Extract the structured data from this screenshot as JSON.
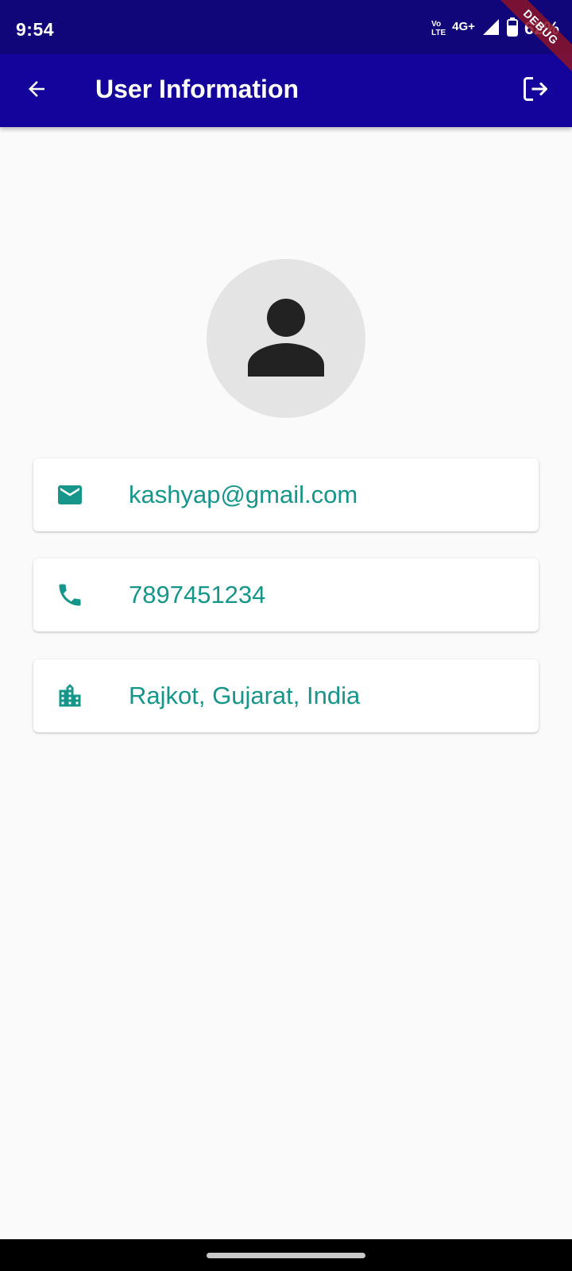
{
  "status_bar": {
    "time": "9:54",
    "volte_top": "Vo",
    "volte_bottom": "LTE",
    "network": "4G+",
    "battery": "62%"
  },
  "debug_banner": "DEBUG",
  "app_bar": {
    "title": "User Information",
    "back_icon": "arrow-back-icon",
    "logout_icon": "logout-icon",
    "background": "#15049b"
  },
  "avatar": {
    "icon": "person-icon"
  },
  "info": {
    "email": "kashyap@gmail.com",
    "phone": "7897451234",
    "location": "Rajkot, Gujarat, India"
  },
  "colors": {
    "accent": "#16968a",
    "status_bar": "#10067a",
    "background": "#fafafa"
  }
}
